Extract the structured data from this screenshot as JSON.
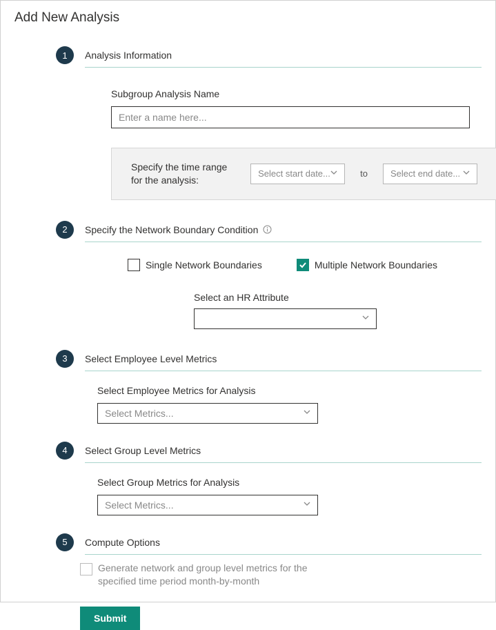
{
  "pageTitle": "Add New Analysis",
  "steps": {
    "s1": {
      "num": "1",
      "title": "Analysis Information",
      "nameLabel": "Subgroup Analysis Name",
      "namePlaceholder": "Enter a name here...",
      "timeRangeLabel": "Specify the time range for the analysis:",
      "startPlaceholder": "Select start date...",
      "to": "to",
      "endPlaceholder": "Select end date..."
    },
    "s2": {
      "num": "2",
      "title": "Specify the Network Boundary Condition",
      "single": "Single Network Boundaries",
      "multiple": "Multiple Network Boundaries",
      "hrLabel": "Select an HR Attribute",
      "hrValue": "",
      "multipleChecked": true,
      "singleChecked": false
    },
    "s3": {
      "num": "3",
      "title": "Select Employee Level Metrics",
      "metricsLabel": "Select Employee Metrics for Analysis",
      "metricsPlaceholder": "Select Metrics..."
    },
    "s4": {
      "num": "4",
      "title": "Select Group Level Metrics",
      "metricsLabel": "Select Group Metrics for Analysis",
      "metricsPlaceholder": "Select Metrics..."
    },
    "s5": {
      "num": "5",
      "title": "Compute Options",
      "generateLabel": "Generate network and group level metrics for the specified time period month-by-month",
      "submit": "Submit"
    }
  }
}
